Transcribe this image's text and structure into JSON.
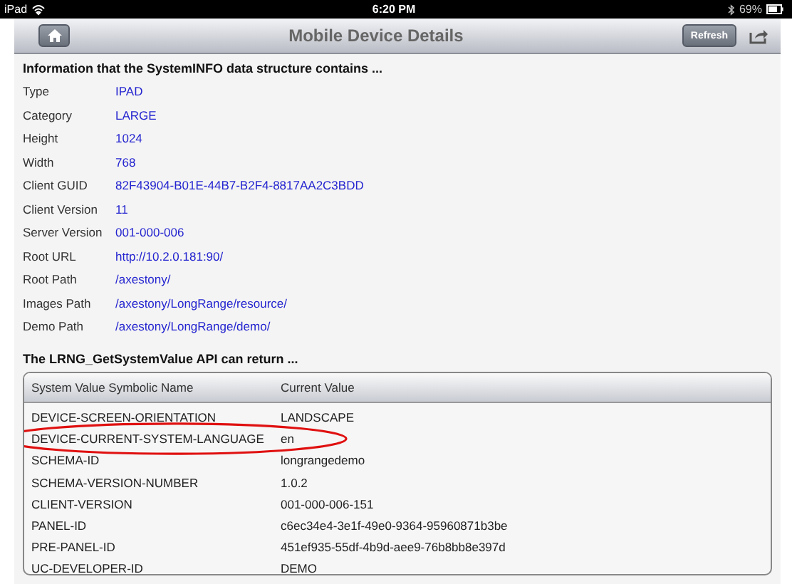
{
  "status_bar": {
    "device": "iPad",
    "time": "6:20 PM",
    "battery": "69%"
  },
  "nav_bar": {
    "title": "Mobile Device Details",
    "refresh": "Refresh"
  },
  "info": {
    "heading": "Information that the SystemINFO data structure contains ...",
    "rows": [
      {
        "label": "Type",
        "value": "IPAD"
      },
      {
        "label": "Category",
        "value": "LARGE"
      },
      {
        "label": "Height",
        "value": "1024"
      },
      {
        "label": "Width",
        "value": "768"
      },
      {
        "label": "Client GUID",
        "value": "82F43904-B01E-44B7-B2F4-8817AA2C3BDD"
      },
      {
        "label": "Client Version",
        "value": "11"
      },
      {
        "label": "Server Version",
        "value": "001-000-006"
      },
      {
        "label": "Root URL",
        "value": "http://10.2.0.181:90/"
      },
      {
        "label": "Root Path",
        "value": "/axestony/"
      },
      {
        "label": "Images Path",
        "value": "/axestony/LongRange/resource/"
      },
      {
        "label": "Demo Path",
        "value": "/axestony/LongRange/demo/"
      }
    ]
  },
  "api": {
    "heading": "The LRNG_GetSystemValue API can return ...",
    "columns": [
      "System Value Symbolic Name",
      "Current Value"
    ],
    "rows": [
      {
        "name": "DEVICE-SCREEN-ORIENTATION",
        "value": "LANDSCAPE",
        "circled": false
      },
      {
        "name": "DEVICE-CURRENT-SYSTEM-LANGUAGE",
        "value": "en",
        "circled": true
      },
      {
        "name": "SCHEMA-ID",
        "value": "longrangedemo",
        "circled": false
      },
      {
        "name": "SCHEMA-VERSION-NUMBER",
        "value": "1.0.2",
        "circled": false
      },
      {
        "name": "CLIENT-VERSION",
        "value": "001-000-006-151",
        "circled": false
      },
      {
        "name": "PANEL-ID",
        "value": "c6ec34e4-3e1f-49e0-9364-95960871b3be",
        "circled": false
      },
      {
        "name": "PRE-PANEL-ID",
        "value": "451ef935-55df-4b9d-aee9-76b8bb8e397d",
        "circled": false
      },
      {
        "name": "UC-DEVELOPER-ID",
        "value": "DEMO",
        "circled": false
      }
    ]
  }
}
